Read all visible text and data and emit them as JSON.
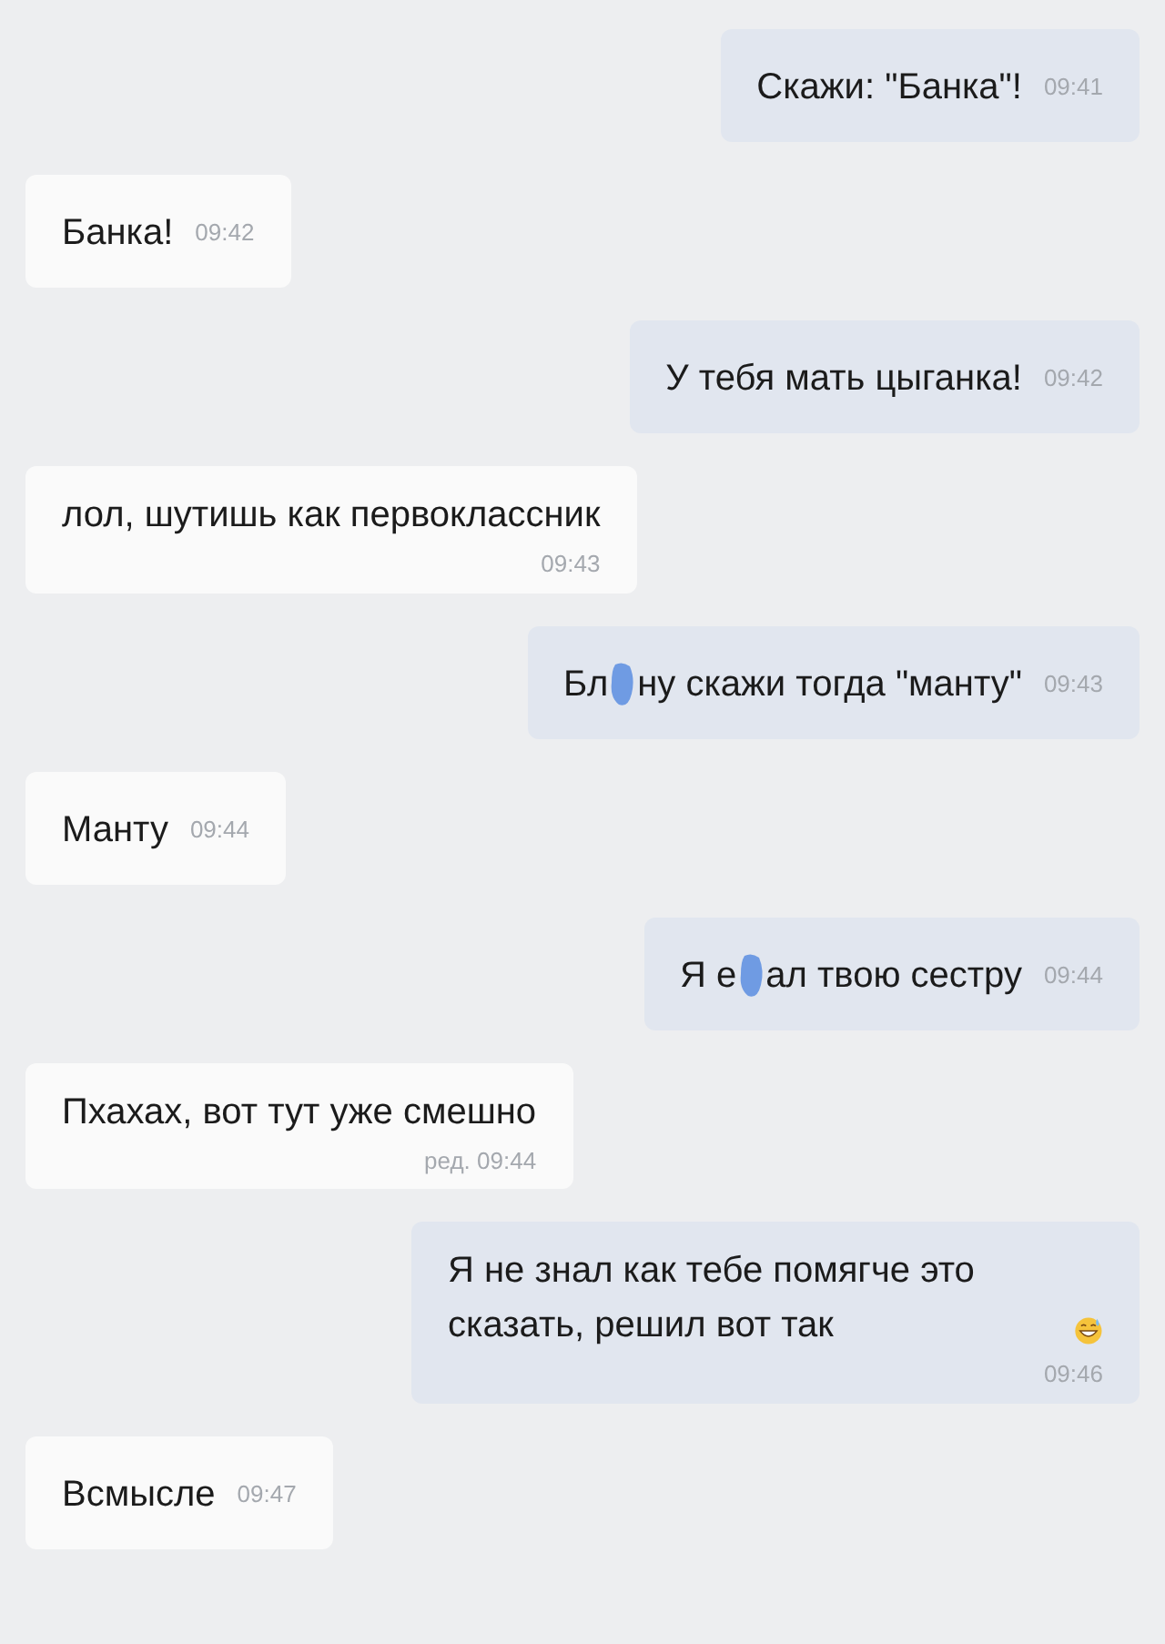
{
  "messages": [
    {
      "outgoing": true,
      "time_below": false,
      "parts": [
        {
          "kind": "text",
          "text": "Скажи: \"Банка\"!"
        }
      ],
      "time": "09:41"
    },
    {
      "outgoing": false,
      "time_below": false,
      "parts": [
        {
          "kind": "text",
          "text": "Банка!"
        }
      ],
      "time": "09:42"
    },
    {
      "outgoing": true,
      "time_below": false,
      "parts": [
        {
          "kind": "text",
          "text": "У тебя мать цыганка!"
        }
      ],
      "time": "09:42"
    },
    {
      "outgoing": false,
      "time_below": true,
      "parts": [
        {
          "kind": "text",
          "text": "лол, шутишь как первоклассник"
        }
      ],
      "time": "09:43"
    },
    {
      "outgoing": true,
      "time_below": false,
      "parts": [
        {
          "kind": "text",
          "text": "Бл"
        },
        {
          "kind": "censor"
        },
        {
          "kind": "text",
          "text": "ну скажи тогда \"манту\""
        }
      ],
      "time": "09:43"
    },
    {
      "outgoing": false,
      "time_below": false,
      "parts": [
        {
          "kind": "text",
          "text": "Манту"
        }
      ],
      "time": "09:44"
    },
    {
      "outgoing": true,
      "time_below": false,
      "parts": [
        {
          "kind": "text",
          "text": "Я е"
        },
        {
          "kind": "censor"
        },
        {
          "kind": "text",
          "text": "ал твою сестру"
        }
      ],
      "time": "09:44"
    },
    {
      "outgoing": false,
      "time_below": true,
      "parts": [
        {
          "kind": "text",
          "text": "Пхахах, вот тут уже смешно"
        }
      ],
      "time": "ред. 09:44"
    },
    {
      "outgoing": true,
      "time_below": true,
      "parts": [
        {
          "kind": "text",
          "text": "Я не знал как тебе помягче это сказать, решил вот так"
        },
        {
          "kind": "emoji"
        }
      ],
      "time": "09:46"
    },
    {
      "outgoing": false,
      "time_below": false,
      "parts": [
        {
          "kind": "text",
          "text": "Всмысле"
        }
      ],
      "time": "09:47"
    }
  ]
}
